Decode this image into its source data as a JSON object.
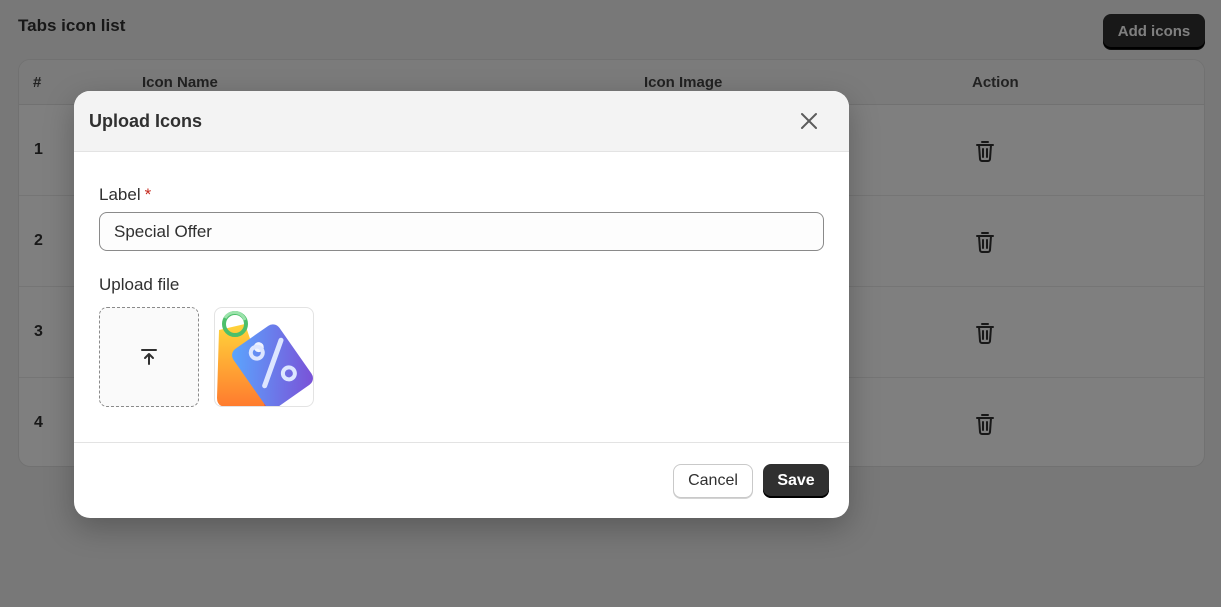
{
  "page": {
    "title": "Tabs icon list",
    "add_button_label": "Add icons"
  },
  "table": {
    "headers": {
      "index": "#",
      "icon_name": "Icon Name",
      "icon_image": "Icon Image",
      "action": "Action"
    },
    "rows": [
      {
        "num": "1"
      },
      {
        "num": "2"
      },
      {
        "num": "3"
      },
      {
        "num": "4"
      }
    ]
  },
  "modal": {
    "title": "Upload Icons",
    "label_field": {
      "label": "Label",
      "required_marker": "*",
      "value": "Special Offer"
    },
    "upload_label": "Upload file",
    "cancel_label": "Cancel",
    "save_label": "Save"
  },
  "icons": {
    "close": "close-icon",
    "upload": "upload-icon",
    "delete": "trash-icon",
    "preview": "discount-tag-image"
  },
  "colors": {
    "primary_button": "#303030",
    "required": "#c5281c",
    "overlay": "rgba(0,0,0,0.5)"
  }
}
